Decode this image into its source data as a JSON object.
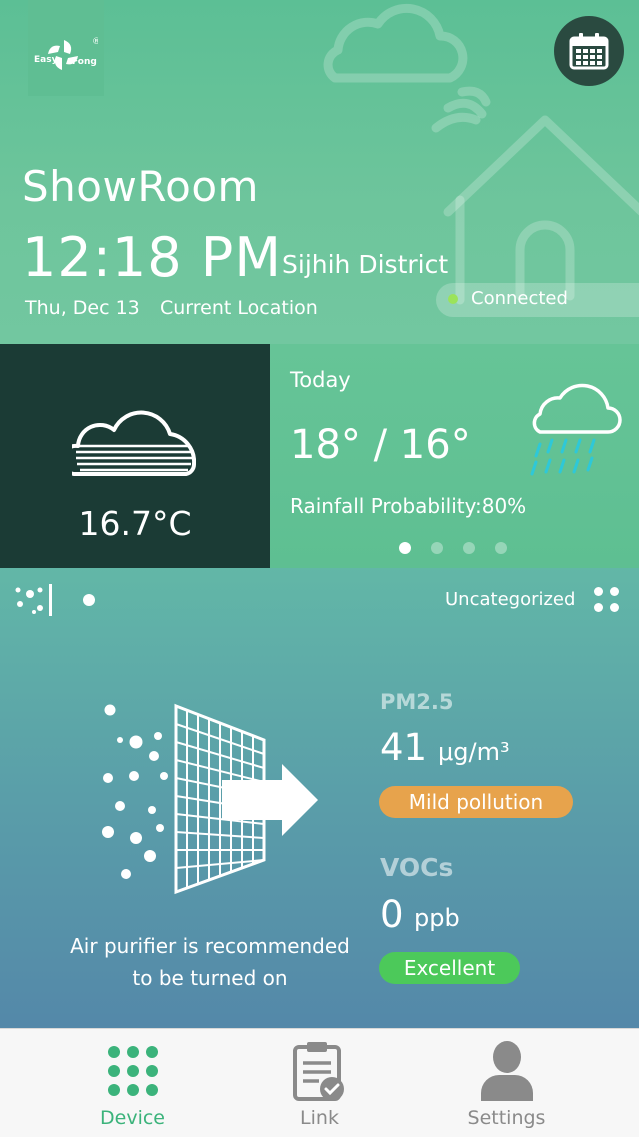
{
  "header": {
    "logo_text": "Easy Fong",
    "device_name": "ShowRoom",
    "time": "12:18 PM",
    "district": "Sijhih District",
    "date": "Thu, Dec 13",
    "location_label": "Current Location",
    "status": "Connected",
    "status_color": "#9be35a",
    "calendar_icon": "calendar-icon"
  },
  "weather": {
    "current_temp": "16.7°C",
    "current_icon": "cloud-fog-icon",
    "forecast_day": "Today",
    "temp_range": "18° / 16°",
    "rain_probability": "Rainfall Probability:80%",
    "forecast_icon": "rain-cloud-icon",
    "page_count": 4,
    "active_page": 1
  },
  "air": {
    "category": "Uncategorized",
    "advice_line1": "Air purifier is recommended",
    "advice_line2": "to be turned on",
    "pm25": {
      "label": "PM2.5",
      "value": "41",
      "unit": "μg/m³",
      "status": "Mild pollution",
      "status_color": "#e7a34c"
    },
    "vocs": {
      "label": "VOCs",
      "value": "0",
      "unit": "ppb",
      "status": "Excellent",
      "status_color": "#4cc95a"
    }
  },
  "tabs": [
    {
      "label": "Device",
      "icon": "device-grid-icon",
      "active": true
    },
    {
      "label": "Link",
      "icon": "clipboard-check-icon",
      "active": false
    },
    {
      "label": "Settings",
      "icon": "user-icon",
      "active": false
    }
  ],
  "colors": {
    "accent": "#3bb37b",
    "header_bg": "#6ec59c",
    "dark_panel": "#1b3b35"
  }
}
